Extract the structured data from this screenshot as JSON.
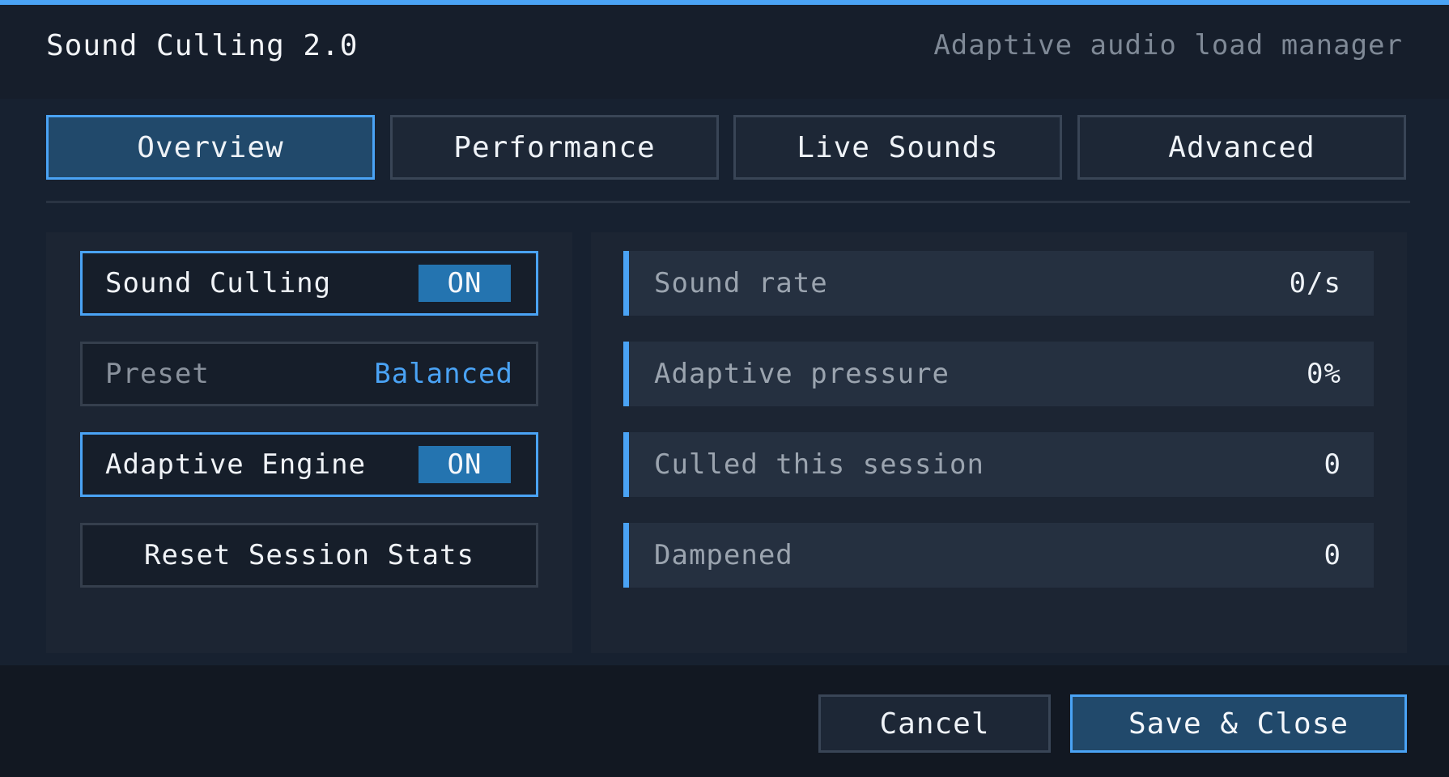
{
  "window": {
    "title": "Sound Culling 2.0",
    "subtitle": "Adaptive audio load manager",
    "accent_color": "#4aa3f5"
  },
  "tabs": [
    {
      "label": "Overview",
      "active": true
    },
    {
      "label": "Performance",
      "active": false
    },
    {
      "label": "Live Sounds",
      "active": false
    },
    {
      "label": "Advanced",
      "active": false
    }
  ],
  "controls": {
    "sound_culling": {
      "label": "Sound Culling",
      "state": "ON"
    },
    "preset": {
      "label": "Preset",
      "value": "Balanced"
    },
    "adaptive_engine": {
      "label": "Adaptive Engine",
      "state": "ON"
    },
    "reset_button": "Reset Session Stats"
  },
  "stats": [
    {
      "label": "Sound rate",
      "value": "0/s"
    },
    {
      "label": "Adaptive pressure",
      "value": "0%"
    },
    {
      "label": "Culled this session",
      "value": "0"
    },
    {
      "label": "Dampened",
      "value": "0"
    }
  ],
  "footer": {
    "cancel_label": "Cancel",
    "save_label": "Save & Close"
  }
}
